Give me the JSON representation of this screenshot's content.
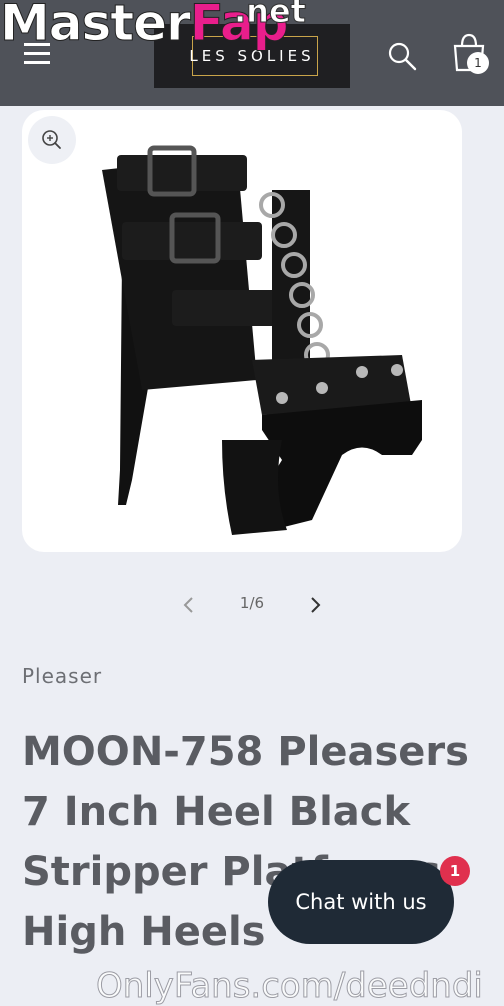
{
  "watermark": {
    "master": "Master",
    "fap": "Fap",
    "net": ".net"
  },
  "header": {
    "logo_text": "LES SOLIES",
    "cart_count": "1"
  },
  "product": {
    "pager": "1/6",
    "vendor": "Pleaser",
    "title": "MOON-758 Pleasers 7 Inch Heel Black Stripper Platforms High Heels"
  },
  "chat": {
    "label": "Chat with us",
    "badge": "1"
  },
  "footer_watermark": "OnlyFans.com/deedndi",
  "colors": {
    "header_bg": "#4f5259",
    "page_bg": "#eceef4",
    "chat_bg": "#1f2a36",
    "badge": "#e0304e"
  },
  "icons": [
    "menu-icon",
    "search-icon",
    "cart-icon",
    "zoom-icon",
    "chevron-left-icon",
    "chevron-right-icon"
  ]
}
